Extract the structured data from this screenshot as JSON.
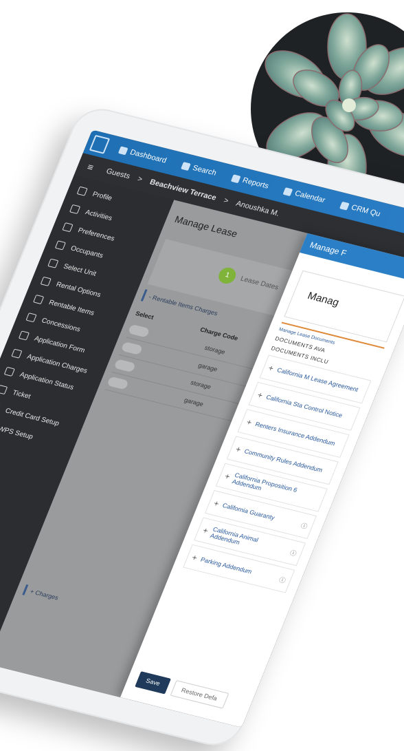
{
  "colors": {
    "topbar": "#1e6fb3",
    "sidebar": "#2b2d30",
    "accent_green": "#7fb33a",
    "orange_rule": "#e08a3c",
    "save_button": "#1f3a5a"
  },
  "topnav": {
    "items": [
      {
        "icon": "dashboard-icon",
        "label": "Dashboard"
      },
      {
        "icon": "search-icon",
        "label": "Search"
      },
      {
        "icon": "reports-icon",
        "label": "Reports"
      },
      {
        "icon": "calendar-icon",
        "label": "Calendar"
      },
      {
        "icon": "crm-icon",
        "label": "CRM Qu"
      }
    ]
  },
  "breadcrumb": {
    "items": [
      "Guests",
      ">",
      "Beachview Terrace",
      ">",
      "Anoushka M."
    ]
  },
  "sidebar": {
    "items": [
      {
        "icon": "profile-icon",
        "label": "Profile"
      },
      {
        "icon": "activities-icon",
        "label": "Activities"
      },
      {
        "icon": "preferences-icon",
        "label": "Preferences"
      },
      {
        "icon": "occupants-icon",
        "label": "Occupants"
      },
      {
        "icon": "select-unit-icon",
        "label": "Select Unit"
      },
      {
        "icon": "rental-options-icon",
        "label": "Rental Options"
      },
      {
        "icon": "rentable-items-icon",
        "label": "Rentable Items"
      },
      {
        "icon": "concessions-icon",
        "label": "Concessions"
      },
      {
        "icon": "application-form-icon",
        "label": "Application Form"
      },
      {
        "icon": "application-charges-icon",
        "label": "Application Charges"
      },
      {
        "icon": "application-status-icon",
        "label": "Application Status"
      },
      {
        "icon": "ticket-icon",
        "label": "Ticket"
      },
      {
        "icon": "credit-card-icon",
        "label": "Credit Card Setup"
      },
      {
        "icon": "wps-icon",
        "label": "WPS Setup"
      }
    ]
  },
  "manage_lease": {
    "title": "Manage Lease",
    "step_number": "1",
    "step_label": "Lease Dates",
    "section_rentable": "- Rentable Items Charges",
    "col_select": "Select",
    "col_charge_code": "Charge Code",
    "rows": [
      "storage",
      "garage",
      "storage",
      "garage"
    ],
    "section_charges": "+ Charges"
  },
  "manage_form": {
    "header": "Manage F",
    "card_title": "Manag",
    "mini_link": "Manage Lease Documents",
    "docs_available": "DOCUMENTS AVA",
    "docs_included": "DOCUMENTS INCLU",
    "documents": [
      "California M Lease Agreement",
      "California Sta Control Notice",
      "Renters Insurance Addendum",
      "Community Rules Addendum",
      "California Proposition 6 Addendum",
      "California Guaranty",
      "California Animal Addendum",
      "Parking Addendum"
    ],
    "save_label": "Save",
    "restore_label": "Restore Defa"
  }
}
